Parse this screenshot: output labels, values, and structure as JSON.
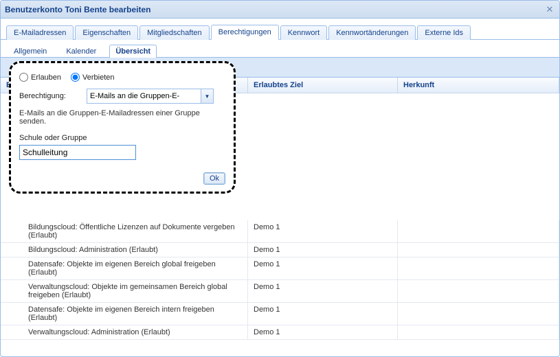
{
  "window": {
    "title": "Benutzerkonto Toni Bente bearbeiten"
  },
  "tabs": {
    "items": [
      {
        "label": "E-Mailadressen"
      },
      {
        "label": "Eigenschaften"
      },
      {
        "label": "Mitgliedschaften"
      },
      {
        "label": "Berechtigungen"
      },
      {
        "label": "Kennwort"
      },
      {
        "label": "Kennwortänderungen"
      },
      {
        "label": "Externe Ids"
      }
    ],
    "activeIndex": 3
  },
  "subtabs": {
    "items": [
      {
        "label": "Allgemein"
      },
      {
        "label": "Kalender"
      },
      {
        "label": "Übersicht"
      }
    ],
    "activeIndex": 2
  },
  "grid": {
    "columns": {
      "c1": "Berechtigung",
      "c2": "Erlaubtes Ziel",
      "c3": "Herkunft"
    },
    "rows": [
      {
        "perm": "Bildungscloud: Öffentliche Lizenzen auf Dokumente vergeben (Erlaubt)",
        "target": "Demo 1",
        "origin": ""
      },
      {
        "perm": "Bildungscloud: Administration (Erlaubt)",
        "target": "Demo 1",
        "origin": ""
      },
      {
        "perm": "Datensafe: Objekte im eigenen Bereich global freigeben (Erlaubt)",
        "target": "Demo 1",
        "origin": ""
      },
      {
        "perm": "Verwaltungscloud: Objekte im gemeinsamen Bereich global freigeben (Erlaubt)",
        "target": "Demo 1",
        "origin": ""
      },
      {
        "perm": "Datensafe: Objekte im eigenen Bereich intern freigeben (Erlaubt)",
        "target": "Demo 1",
        "origin": ""
      },
      {
        "perm": "Verwaltungscloud: Administration (Erlaubt)",
        "target": "Demo 1",
        "origin": ""
      }
    ]
  },
  "popup": {
    "radioAllow": "Erlauben",
    "radioDeny": "Verbieten",
    "selectedRadio": "deny",
    "permLabel": "Berechtigung:",
    "permValue": "E-Mails an die Gruppen-E-",
    "desc": "E-Mails an die Gruppen-E-Mailadressen einer Gruppe senden.",
    "targetLabel": "Schule oder Gruppe",
    "targetValue": "Schulleitung",
    "okLabel": "Ok"
  }
}
